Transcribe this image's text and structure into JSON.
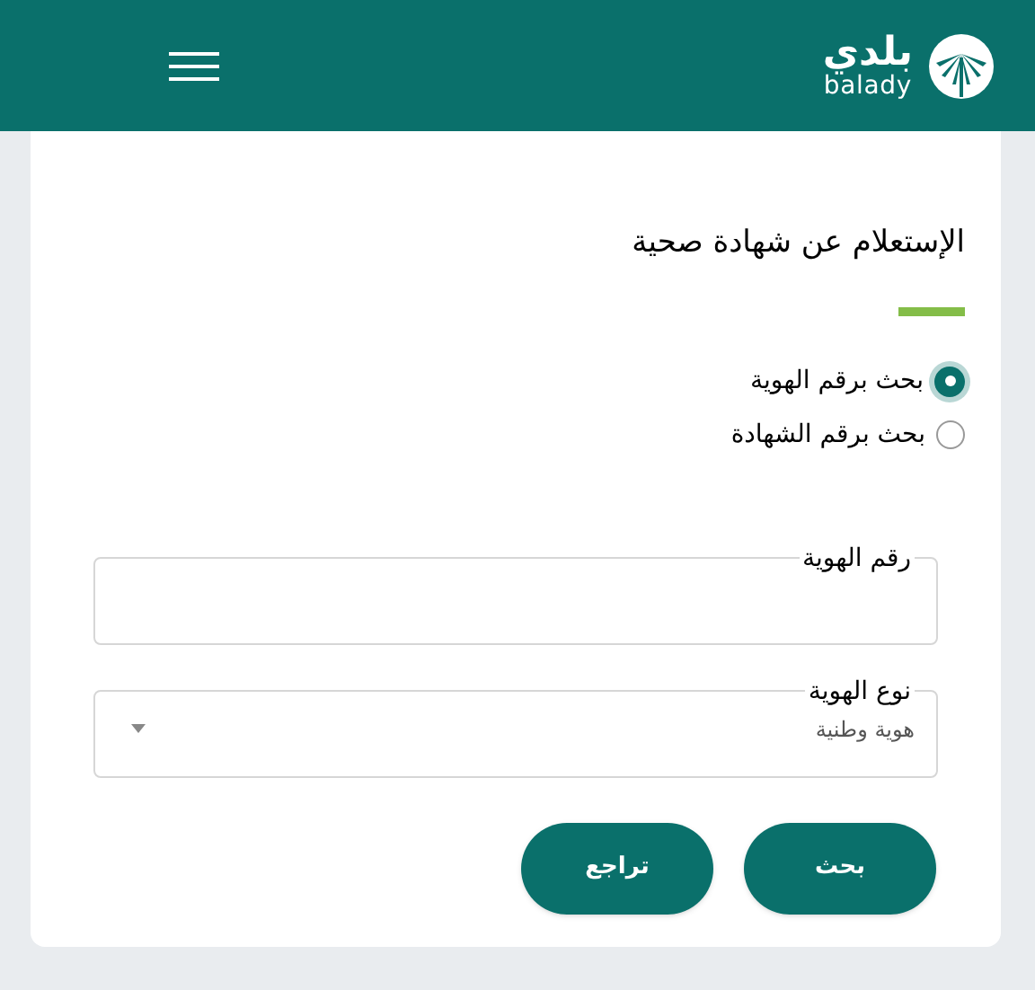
{
  "header": {
    "logo_arabic": "بلدي",
    "logo_latin": "balady"
  },
  "title": "الإستعلام عن شهادة صحية",
  "search_options": [
    {
      "label": "بحث برقم الهوية",
      "selected": true
    },
    {
      "label": "بحث برقم الشهادة",
      "selected": false
    }
  ],
  "fields": [
    {
      "kind": "text",
      "label": "رقم الهوية"
    },
    {
      "kind": "select",
      "label": "نوع الهوية",
      "value": "هوية وطنية"
    }
  ],
  "buttons": [
    "بحث",
    "تراجع"
  ]
}
